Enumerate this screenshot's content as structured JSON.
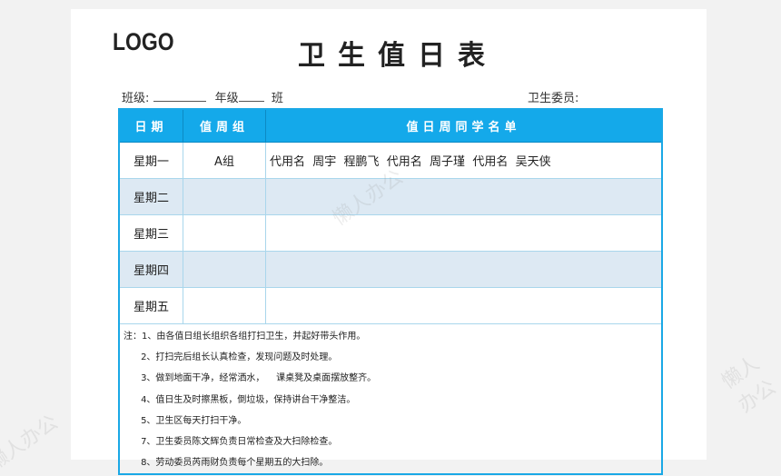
{
  "logo": "LOGO",
  "title": "卫生值日表",
  "info": {
    "class_label": "班级:",
    "grade_label": "年级",
    "ban_label": "班",
    "committee_label": "卫生委员:"
  },
  "table": {
    "headers": [
      "日期",
      "值周组",
      "值日周同学名单"
    ],
    "rows": [
      {
        "day": "星期一",
        "group": "A组",
        "names": "代用名  周宇  程鹏飞  代用名  周子瑾  代用名  吴天侠"
      },
      {
        "day": "星期二",
        "group": "",
        "names": ""
      },
      {
        "day": "星期三",
        "group": "",
        "names": ""
      },
      {
        "day": "星期四",
        "group": "",
        "names": ""
      },
      {
        "day": "星期五",
        "group": "",
        "names": ""
      }
    ]
  },
  "notes": [
    "注：1、由各值日组长组织各组打扫卫生，并起好带头作用。",
    "      2、打扫完后组长认真检查，发现问题及时处理。",
    "      3、做到地面干净，经常洒水，    课桌凳及桌面摆放整齐。",
    "      4、值日生及时擦黑板，倒垃圾，保持讲台干净整洁。",
    "      5、卫生区每天打扫干净。",
    "      7、卫生委员陈文辉负责日常检查及大扫除检查。",
    "      8、劳动委员芮雨财负责每个星期五的大扫除。"
  ],
  "watermark": "懒人办公",
  "colors": {
    "header": "#14a9ea",
    "alt_row": "#dde9f3"
  }
}
